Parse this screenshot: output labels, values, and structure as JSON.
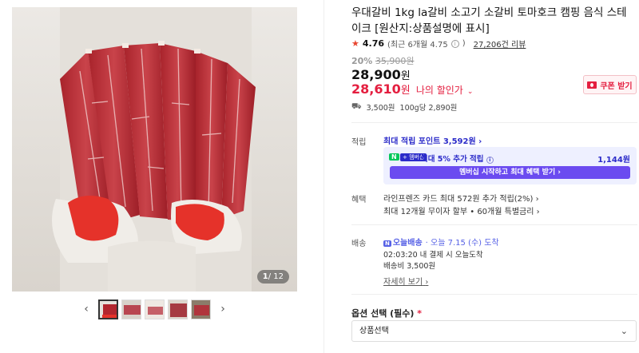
{
  "gallery": {
    "counter_current": "1",
    "counter_total": "/ 12",
    "prev_icon": "chevron-left-icon",
    "next_icon": "chevron-right-icon",
    "thumbnail_count": 5
  },
  "product": {
    "title": "우대갈비 1kg la갈비 소고기 소갈비 토마호크 캠핑 음식 스테이크 [원산지:상품설명에 표시]",
    "rating_star": "★",
    "rating_score": "4.76",
    "rating_recent": "(최근 6개월 4.75",
    "rating_recent_close": ")",
    "review_count": "27,206건 리뷰",
    "discount_pct": "20%",
    "original_price": "35,900원",
    "sale_price": "28,900",
    "sale_price_unit": "원",
    "my_price": "28,610",
    "my_price_unit": "원",
    "my_price_label": "나의 할인가",
    "coupon_label": "쿠폰 받기",
    "shipping_fee": "3,500원",
    "unit_price": "100g당 2,890원"
  },
  "points": {
    "section_label": "적립",
    "max_points_link": "최대 적립 포인트 3,592원",
    "np_badge": "N",
    "plus_badge": "+ 멤버십",
    "extra_text": "최대 5% 추가 적립",
    "extra_amount": "1,144원",
    "member_button": "멤버십 시작하고 최대 혜택 받기"
  },
  "benefits": {
    "section_label": "혜택",
    "line1": "라인프렌즈 카드 최대 572원 추가 적립(2%)",
    "line2": "최대 12개월 무이자 할부 • 60개월 특별금리"
  },
  "delivery": {
    "section_label": "배송",
    "today_badge": "오늘배송",
    "today_badge_n": "N",
    "today_date": "· 오늘 7.15 (수) 도착",
    "countdown": "02:03:20  내 결제 시 오늘도착",
    "shipping_fee": "배송비 3,500원",
    "more_link": "자세히 보기"
  },
  "option": {
    "label": "옵션 선택 (필수)",
    "required_mark": "*",
    "select_value": "상품선택"
  },
  "colors": {
    "accent_red": "#e41e3f",
    "naver_blue": "#2b2bc9",
    "member_purple": "#6b4bf0",
    "naver_green": "#03c75a"
  }
}
